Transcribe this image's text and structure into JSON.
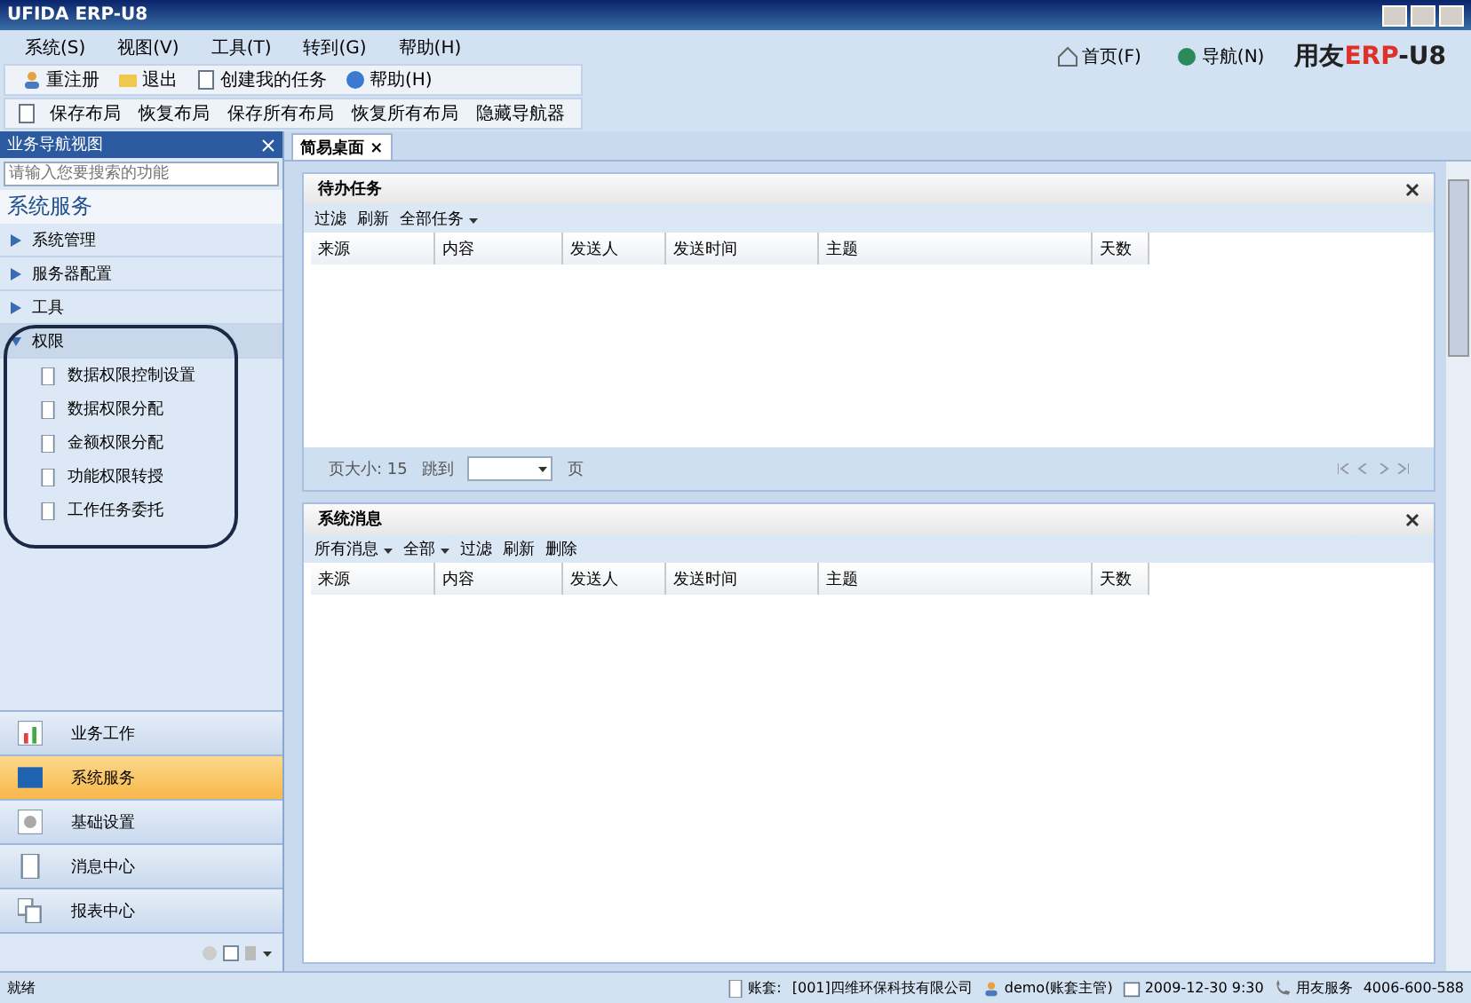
{
  "window": {
    "title": "UFIDA ERP-U8"
  },
  "menu": [
    "系统(S)",
    "视图(V)",
    "工具(T)",
    "转到(G)",
    "帮助(H)"
  ],
  "toolbar": [
    "重注册",
    "退出",
    "创建我的任务",
    "帮助(H)"
  ],
  "layout_toolbar": [
    "保存布局",
    "恢复布局",
    "保存所有布局",
    "恢复所有布局",
    "隐藏导航器"
  ],
  "header_links": [
    "首页(F)",
    "导航(N)"
  ],
  "logo": {
    "text": "用友",
    "accent": "ERP",
    "suffix": "-U8"
  },
  "sidebar": {
    "title": "业务导航视图",
    "search": {
      "placeholder": "请输入您要搜索的功能"
    },
    "heading": "系统服务",
    "items": [
      {
        "label": "系统管理",
        "expanded": false
      },
      {
        "label": "服务器配置",
        "expanded": false
      },
      {
        "label": "工具",
        "expanded": false
      },
      {
        "label": "权限",
        "expanded": true,
        "children": [
          {
            "label": "数据权限控制设置"
          },
          {
            "label": "数据权限分配"
          },
          {
            "label": "金额权限分配"
          },
          {
            "label": "功能权限转授"
          },
          {
            "label": "工作任务委托"
          }
        ]
      }
    ],
    "modules": [
      {
        "label": "业务工作",
        "selected": false
      },
      {
        "label": "系统服务",
        "selected": true
      },
      {
        "label": "基础设置",
        "selected": false
      },
      {
        "label": "消息中心",
        "selected": false
      },
      {
        "label": "报表中心",
        "selected": false
      }
    ]
  },
  "tabs": [
    {
      "label": "简易桌面",
      "close": "×",
      "selected": true
    }
  ],
  "panels": [
    {
      "title": "待办任务",
      "actions": [
        {
          "label": "过滤",
          "dropdown": false
        },
        {
          "label": "刷新",
          "dropdown": false
        },
        {
          "label": "全部任务",
          "dropdown": true
        }
      ],
      "columns": [
        "来源",
        "内容",
        "发送人",
        "发送时间",
        "主题",
        "天数"
      ],
      "pager": {
        "size_label": "页大小:",
        "size": "15",
        "jump_label": "跳到",
        "page_label": "页"
      }
    },
    {
      "title": "系统消息",
      "actions": [
        {
          "label": "所有消息",
          "dropdown": true
        },
        {
          "label": "全部",
          "dropdown": true
        },
        {
          "label": "过滤",
          "dropdown": false
        },
        {
          "label": "刷新",
          "dropdown": false
        },
        {
          "label": "删除",
          "dropdown": false
        }
      ],
      "columns": [
        "来源",
        "内容",
        "发送人",
        "发送时间",
        "主题",
        "天数"
      ]
    }
  ],
  "status_bar": {
    "state": "就绪",
    "items": [
      "账套:",
      "[001]四维环保科技有限公司",
      "demo(账套主管)",
      "2009-12-30 9:30",
      "用友服务",
      "4006-600-588"
    ]
  }
}
